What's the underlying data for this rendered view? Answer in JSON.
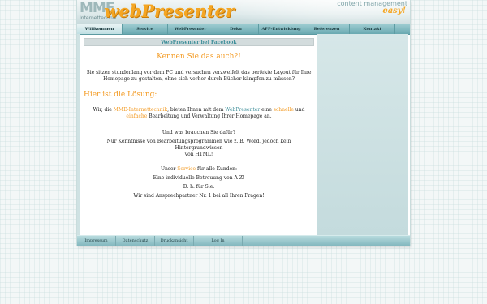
{
  "header": {
    "logo_mme": "MME",
    "logo_sub": "Internettechnik",
    "logo_brand": "webPresenter",
    "tagline": "content management",
    "tagline_sub": "easy!"
  },
  "nav": {
    "items": [
      {
        "label": "Willkommen",
        "active": true
      },
      {
        "label": "Service"
      },
      {
        "label": "WebPresenter"
      },
      {
        "label": "Doku"
      },
      {
        "label": "APP-Entwicklung"
      },
      {
        "label": "Referenzen"
      },
      {
        "label": "Kontakt"
      }
    ]
  },
  "main": {
    "facebook_link": "WebPresenter bei Facebook",
    "heading": "Kennen Sie das auch?!",
    "intro_1": "Sie sitzen stundenlang vor dem PC und versuchen verzweifelt das perfekte Layout für Ihre",
    "intro_2": "Homepage zu gestalten, ohne sich vorher durch Bücher kämpfen zu müssen?",
    "solution_heading": "Hier ist die Lösung:",
    "offer": {
      "t1": "Wir, die ",
      "company": "MME-Internettechnik",
      "t2": ", bieten Ihnen mit dem ",
      "product": "WebPresenter",
      "t3": " eine ",
      "quick": "schnelle",
      "t4": " und",
      "easy": "einfache",
      "t5": " Bearbeitung und Verwaltung Ihrer Homepage an."
    },
    "question": "Und was brauchen Sie dafür?",
    "requirement_1": "Nur Kenntnisse von Bearbeitungsprogrammen wie z. B. Word, jedoch kein Hintergrundwissen",
    "requirement_2": "von HTML!",
    "service": {
      "t1": "Unser ",
      "word": "Service",
      "t2": " für alle Kunden:"
    },
    "support": "Eine individuelle Betreuung von A-Z!",
    "means": "D. h. für Sie:",
    "contact": "Wir sind Ansprechpartner Nr. 1 bei all Ihren Fragen!"
  },
  "footer": {
    "items": [
      "Impressum",
      "Datenschutz",
      "Druckansicht",
      "Log In"
    ]
  },
  "colors": {
    "accent": "#f39b24",
    "link": "#3f8f9a",
    "nav": "#6aa9b1"
  }
}
